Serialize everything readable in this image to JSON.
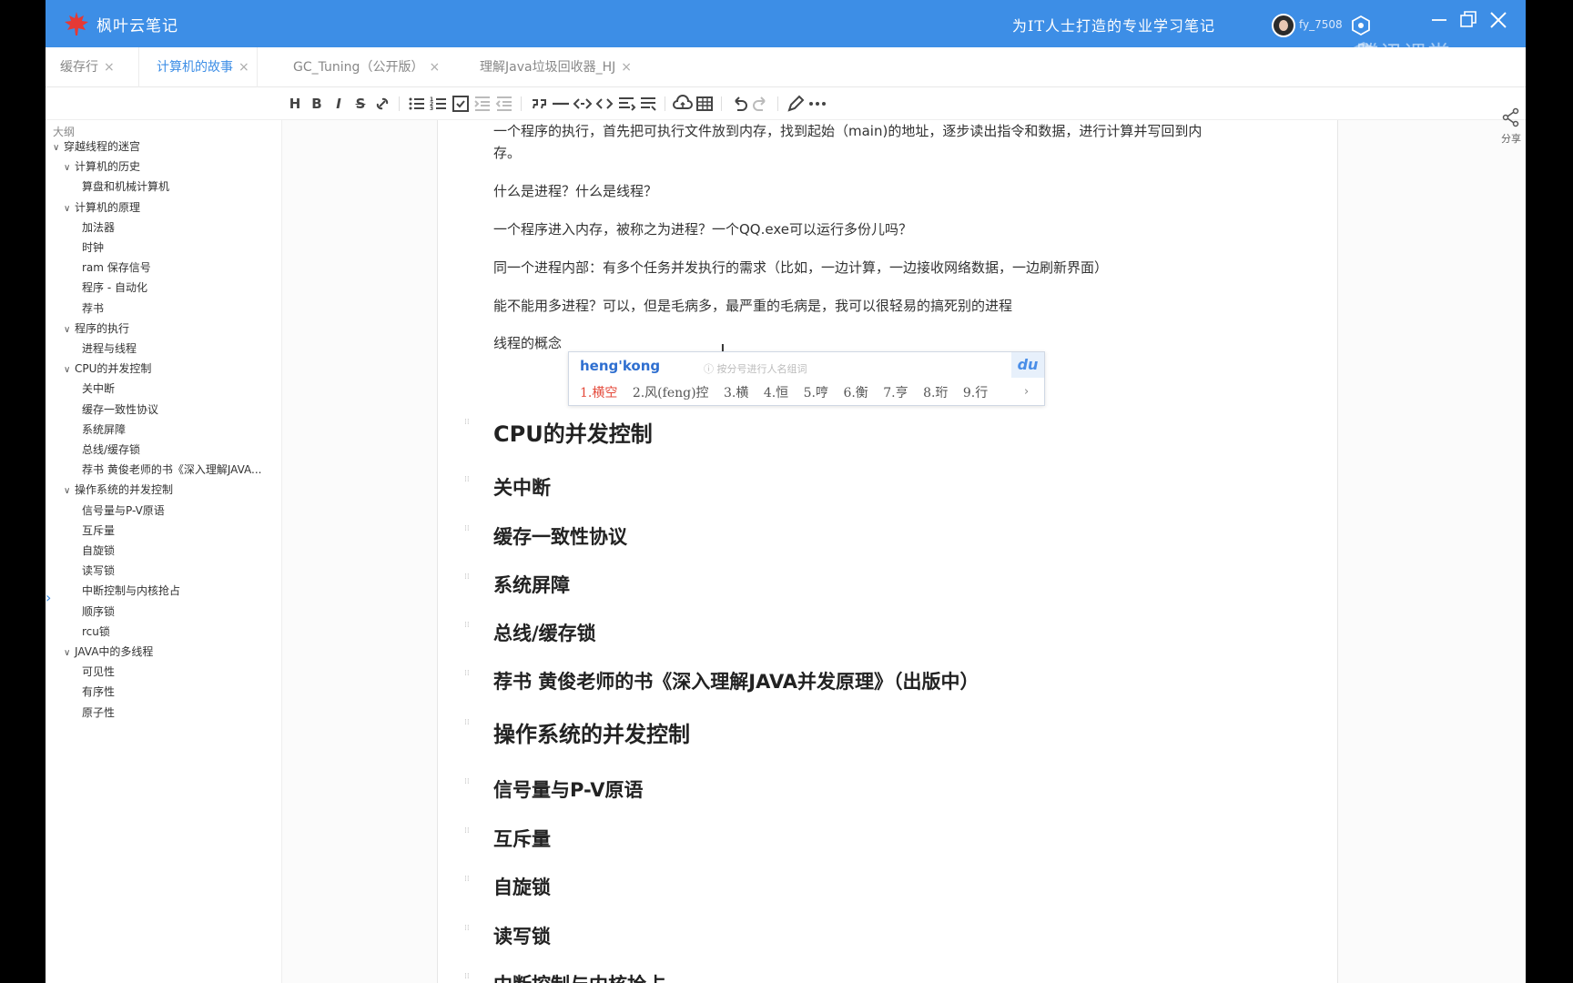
{
  "app": {
    "title": "枫叶云笔记",
    "slogan": "为IT人士打造的专业学习笔记",
    "username": "fy_7508",
    "watermark": "腾讯课堂",
    "accent": "#3d8ee6"
  },
  "tabs": [
    {
      "label": "缓存行",
      "close": "×"
    },
    {
      "label": "计算机的故事",
      "close": "×"
    },
    {
      "label": "GC_Tuning（公开版）",
      "close": "×"
    },
    {
      "label": "理解Java垃圾回收器_HJ",
      "close": "×"
    }
  ],
  "toolbar": {
    "heading": "H",
    "bold": "B",
    "italic": "I",
    "strike": "S",
    "icons": [
      "heading-icon",
      "bold-icon",
      "italic-icon",
      "strikethrough-icon",
      "link-icon",
      "bullet-list-icon",
      "numbered-list-icon",
      "checkbox-list-icon",
      "indent-icon",
      "outdent-icon",
      "quote-icon",
      "hr-icon",
      "code-inline-icon",
      "code-block-icon",
      "format-icon",
      "align-icon",
      "upload-icon",
      "table-icon",
      "undo-icon",
      "redo-icon",
      "pen-icon",
      "more-icon"
    ]
  },
  "outline": {
    "title": "大纲",
    "items": [
      {
        "label": "穿越线程的迷宫",
        "expanded": true
      },
      {
        "label": "计算机的历史",
        "expanded": true
      },
      {
        "label": "算盘和机械计算机"
      },
      {
        "label": "计算机的原理",
        "expanded": true
      },
      {
        "label": "加法器"
      },
      {
        "label": "时钟"
      },
      {
        "label": "ram 保存信号"
      },
      {
        "label": "程序 - 自动化"
      },
      {
        "label": "荐书"
      },
      {
        "label": "程序的执行",
        "expanded": true
      },
      {
        "label": "进程与线程"
      },
      {
        "label": "CPU的并发控制",
        "expanded": true
      },
      {
        "label": "关中断"
      },
      {
        "label": "缓存一致性协议"
      },
      {
        "label": "系统屏障"
      },
      {
        "label": "总线/缓存锁"
      },
      {
        "label": "荐书 黄俊老师的书《深入理解JAVA..."
      },
      {
        "label": "操作系统的并发控制",
        "expanded": true
      },
      {
        "label": "信号量与P-V原语"
      },
      {
        "label": "互斥量"
      },
      {
        "label": "自旋锁"
      },
      {
        "label": "读写锁"
      },
      {
        "label": "中断控制与内核抢占"
      },
      {
        "label": "顺序锁"
      },
      {
        "label": "rcu锁"
      },
      {
        "label": "JAVA中的多线程",
        "expanded": true
      },
      {
        "label": "可见性"
      },
      {
        "label": "有序性"
      },
      {
        "label": "原子性"
      }
    ]
  },
  "doc": {
    "para1_line1": "一个程序的执行，首先把可执行文件放到内存，找到起始（main)的地址，逐步读出指令和数据，进行计算并写回到内",
    "para1_line2": "存。",
    "para2": "什么是进程？什么是线程？",
    "para3": "一个程序进入内存，被称之为进程？一个QQ.exe可以运行多份儿吗？",
    "para4": "同一个进程内部：有多个任务并发执行的需求（比如，一边计算，一边接收网络数据，一边刷新界面）",
    "para5": "能不能用多进程？可以，但是毛病多，最严重的毛病是，我可以很轻易的搞死别的进程",
    "para6": "线程的概念",
    "headings": [
      {
        "text": "CPU的并发控制",
        "level": 2
      },
      {
        "text": "关中断",
        "level": 3
      },
      {
        "text": "缓存一致性协议",
        "level": 3
      },
      {
        "text": "系统屏障",
        "level": 3
      },
      {
        "text": "总线/缓存锁",
        "level": 3
      },
      {
        "text": "荐书 黄俊老师的书《深入理解JAVA并发原理》（出版中）",
        "level": 3
      },
      {
        "text": "操作系统的并发控制",
        "level": 2
      },
      {
        "text": "信号量与P-V原语",
        "level": 3
      },
      {
        "text": "互斥量",
        "level": 3
      },
      {
        "text": "自旋锁",
        "level": 3
      },
      {
        "text": "读写锁",
        "level": 3
      },
      {
        "text": "中断控制与内核抢占",
        "level": 3
      }
    ]
  },
  "ime": {
    "input": "heng'kong",
    "hint": "按分号进行人名组词",
    "logo": "du",
    "candidates": [
      "1.横空",
      "2.风(feng)控",
      "3.横",
      "4.恒",
      "5.哼",
      "6.衡",
      "7.亨",
      "8.珩",
      "9.行"
    ],
    "next": "›"
  },
  "share": {
    "label": "分享"
  }
}
